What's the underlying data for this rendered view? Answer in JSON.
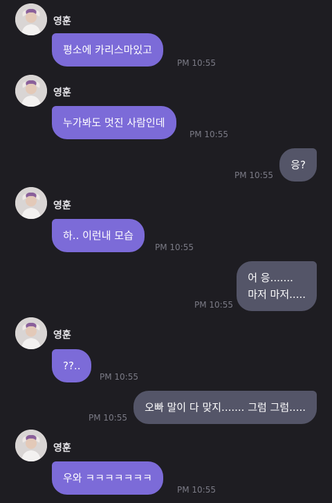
{
  "contact": {
    "name": "영훈"
  },
  "colors": {
    "background": "#1e1d22",
    "incoming_bubble": "#7c6bd8",
    "outgoing_bubble": "#545568",
    "timestamp": "#7b7b86"
  },
  "messages": [
    {
      "side": "them",
      "sender": "영훈",
      "lines": [
        "평소에 카리스마있고"
      ],
      "time": "PM 10:55"
    },
    {
      "side": "them",
      "sender": "영훈",
      "lines": [
        "누가봐도 멋진 사람인데"
      ],
      "time": "PM 10:55"
    },
    {
      "side": "me",
      "lines": [
        "응?"
      ],
      "time": "PM 10:55"
    },
    {
      "side": "them",
      "sender": "영훈",
      "lines": [
        "하.. 이런내 모습"
      ],
      "time": "PM 10:55"
    },
    {
      "side": "me",
      "lines": [
        "어 응.......",
        "마저 마저....."
      ],
      "time": "PM 10:55"
    },
    {
      "side": "them",
      "sender": "영훈",
      "lines": [
        "??.."
      ],
      "time": "PM 10:55"
    },
    {
      "side": "me",
      "lines": [
        "오빠 말이 다 맞지....... 그럼 그럼....."
      ],
      "time": "PM 10:55"
    },
    {
      "side": "them",
      "sender": "영훈",
      "lines": [
        "우와 ㅋㅋㅋㅋㅋㅋㅋ"
      ],
      "time": "PM 10:55"
    }
  ]
}
